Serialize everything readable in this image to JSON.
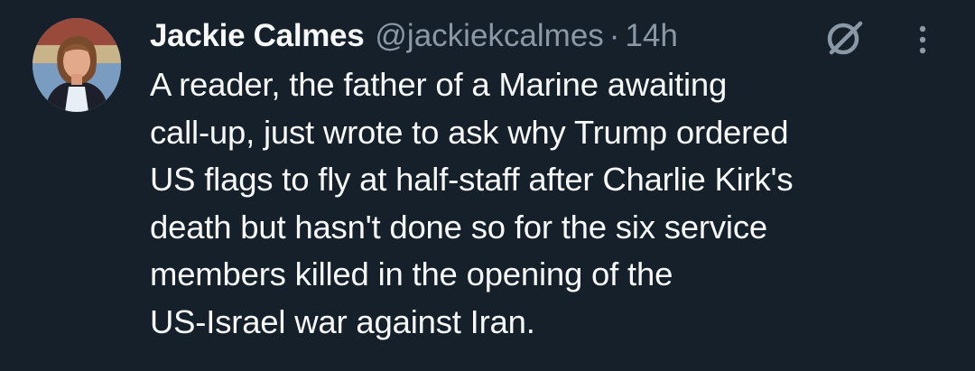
{
  "tweet": {
    "author_name": "Jackie Calmes",
    "handle": "@jackiekcalmes",
    "separator": "·",
    "time_ago": "14h",
    "text": "A reader, the father of a Marine awaiting\ncall-up, just wrote to ask why Trump ordered\nUS flags to fly at half-staff after Charlie Kirk's\ndeath but hasn't done so for the six service\nmembers killed in the opening of the\nUS-Israel war against Iran."
  },
  "icons": {
    "grok": "grok-icon",
    "more": "more-options-icon"
  },
  "colors": {
    "background": "#15202b",
    "primary_text": "#f7f9f9",
    "secondary_text": "#8b98a5"
  }
}
